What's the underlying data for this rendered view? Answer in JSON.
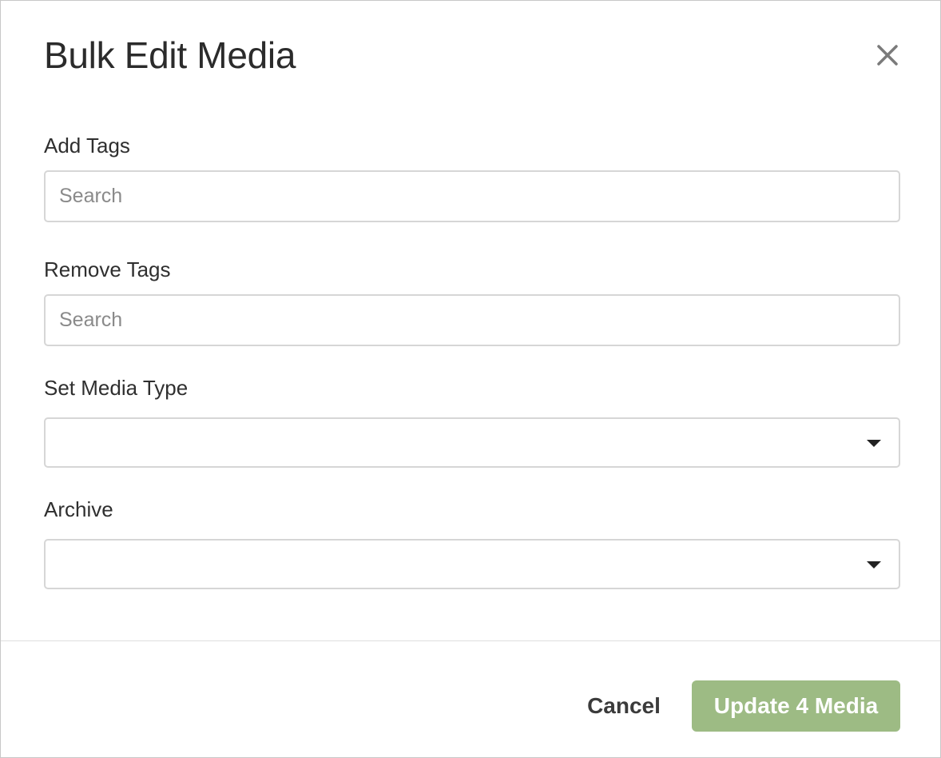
{
  "dialog": {
    "title": "Bulk Edit Media",
    "close_icon": "close-icon"
  },
  "fields": {
    "add_tags": {
      "label": "Add Tags",
      "value": "",
      "placeholder": "Search"
    },
    "remove_tags": {
      "label": "Remove Tags",
      "value": "",
      "placeholder": "Search"
    },
    "media_type": {
      "label": "Set Media Type",
      "selected": "",
      "icon": "chevron-down-icon"
    },
    "archive": {
      "label": "Archive",
      "selected": "",
      "icon": "chevron-down-icon"
    }
  },
  "footer": {
    "cancel_label": "Cancel",
    "submit_label": "Update 4 Media"
  },
  "colors": {
    "primary_button": "#9dbb84",
    "text": "#2b2b2b",
    "border": "#d6d6d6"
  }
}
